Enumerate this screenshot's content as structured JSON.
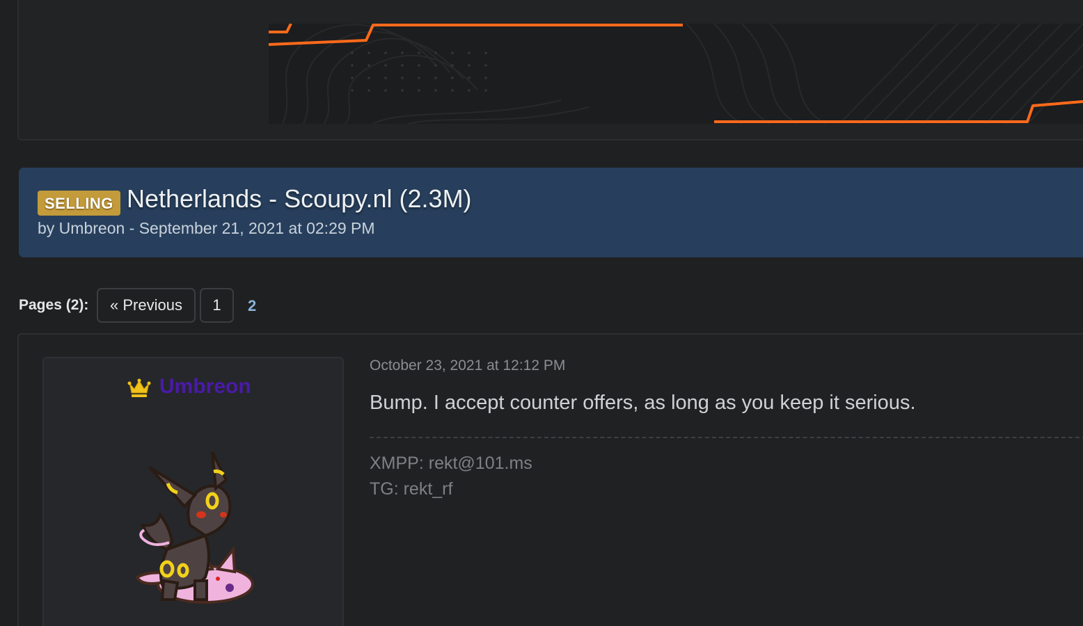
{
  "banner": {
    "partial_text": "                                               ",
    "accent_color": "#ff6a1a"
  },
  "thread": {
    "prefix": "SELLING",
    "title": "Netherlands - Scoupy.nl (2.3M)",
    "meta": "by Umbreon - September 21, 2021 at 02:29 PM",
    "header_color": "#273f5c",
    "prefix_color": "#c49b3a"
  },
  "pagination": {
    "label": "Pages (2):",
    "previous": "« Previous",
    "page_1": "1",
    "current": "2"
  },
  "post": {
    "author": {
      "name": "Umbreon",
      "name_color": "#4a1aa8",
      "rank_icon": "crown-icon",
      "avatar": "umbreon-espeon-avatar"
    },
    "date": "October 23, 2021 at 12:12 PM",
    "body": "Bump. I accept counter offers, as long as you keep it serious.",
    "signature": [
      "XMPP: rekt@101.ms",
      "TG: rekt_rf"
    ]
  }
}
